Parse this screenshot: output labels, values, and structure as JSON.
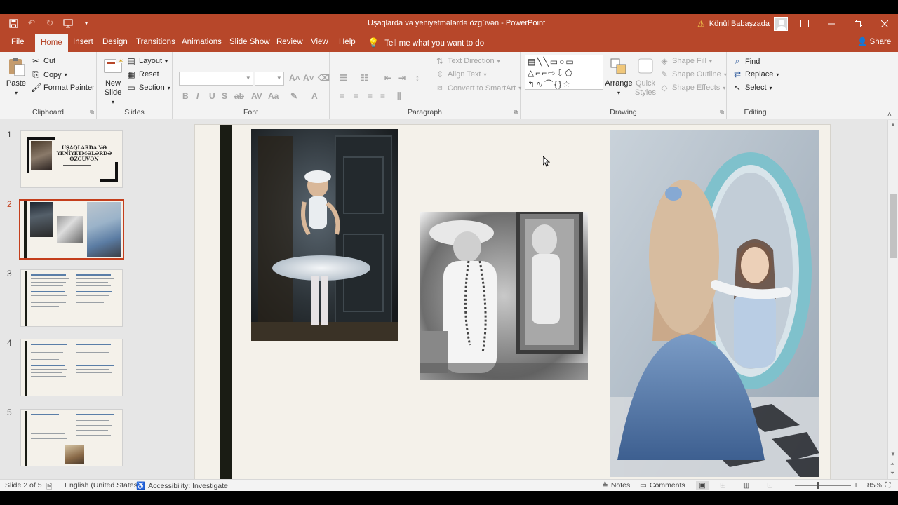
{
  "titlebar": {
    "doc_title": "Uşaqlarda və yeniyetmələrdə özgüvən  -  PowerPoint",
    "user_name": "Könül Babaşzada",
    "colors": {
      "accent": "#b7472a",
      "selected": "#c43e1c"
    }
  },
  "tabs": [
    "File",
    "Home",
    "Insert",
    "Design",
    "Transitions",
    "Animations",
    "Slide Show",
    "Review",
    "View",
    "Help"
  ],
  "active_tab": "Home",
  "tell_me": "Tell me what you want to do",
  "share": "Share",
  "ribbon": {
    "clipboard": {
      "label": "Clipboard",
      "paste": "Paste",
      "cut": "Cut",
      "copy": "Copy",
      "format_painter": "Format Painter"
    },
    "slides": {
      "label": "Slides",
      "new_slide": "New Slide",
      "layout": "Layout",
      "reset": "Reset",
      "section": "Section"
    },
    "font": {
      "label": "Font"
    },
    "paragraph": {
      "label": "Paragraph",
      "text_direction": "Text Direction",
      "align_text": "Align Text",
      "convert_smartart": "Convert to SmartArt"
    },
    "drawing": {
      "label": "Drawing",
      "arrange": "Arrange",
      "quick_styles": "Quick Styles",
      "shape_fill": "Shape Fill",
      "shape_outline": "Shape Outline",
      "shape_effects": "Shape Effects"
    },
    "editing": {
      "label": "Editing",
      "find": "Find",
      "replace": "Replace",
      "select": "Select"
    }
  },
  "thumbnails": {
    "numbers": [
      "1",
      "2",
      "3",
      "4",
      "5"
    ],
    "slide1_title": "UŞAQLARDA VƏ YENİYETMƏLƏRDƏ ÖZGÜVƏN",
    "selected": "2"
  },
  "slide": {
    "photos": [
      "ballerina-photo",
      "girl-mirror-bw-photo",
      "girl-mirror-blue-photo"
    ]
  },
  "statusbar": {
    "slide_of": "Slide 2 of 5",
    "language": "English (United States)",
    "accessibility": "Accessibility: Investigate",
    "notes": "Notes",
    "comments": "Comments",
    "zoom": "85%"
  }
}
